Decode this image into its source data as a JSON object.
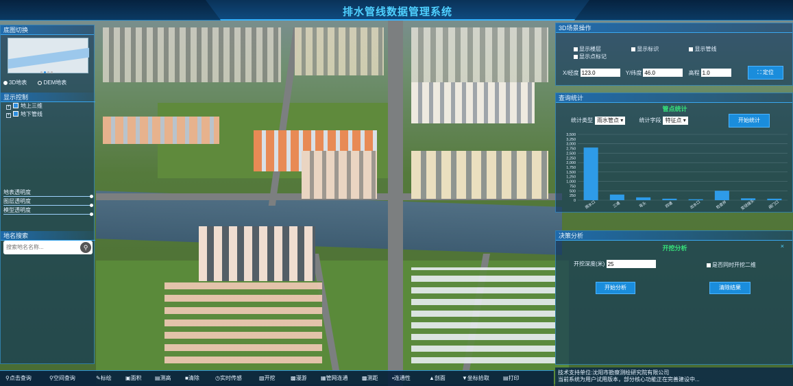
{
  "app": {
    "title": "排水管线数据管理系统"
  },
  "left_panel": {
    "basemap": {
      "header": "底图切换",
      "options": [
        {
          "label": "3D地表",
          "selected": true
        },
        {
          "label": "DEM地表",
          "selected": false
        }
      ]
    },
    "display_control": {
      "header": "显示控制",
      "layers": [
        {
          "label": "地上三维",
          "checked": true
        },
        {
          "label": "地下管线",
          "checked": true
        }
      ]
    },
    "sliders": [
      {
        "label": "地表透明度",
        "value_pct": 100
      },
      {
        "label": "图层透明度",
        "value_pct": 100
      },
      {
        "label": "模型透明度",
        "value_pct": 100
      }
    ],
    "place_search": {
      "header": "地名搜索",
      "placeholder": "搜索地名名称..."
    }
  },
  "right_panel": {
    "scene_ops": {
      "header": "3D场景操作",
      "checkboxes": [
        "显示楼层",
        "显示标识",
        "显示管线",
        "显示点标记"
      ],
      "x_label": "X/经度",
      "x_value": "123.0",
      "y_label": "Y/纬度",
      "y_value": "46.0",
      "z_label": "高程",
      "z_value": "1.0",
      "locate_button": "定位"
    },
    "query_stats": {
      "header": "查询统计",
      "subtitle": "管点统计",
      "type_label": "统计类型",
      "type_value": "雨水管点",
      "field_label": "统计字段",
      "field_value": "特征点",
      "button": "开始统计"
    },
    "decision": {
      "header": "决策分析",
      "subtitle": "开挖分析",
      "close": "×",
      "depth_label": "开挖深度(米)",
      "depth_value": "25",
      "checkbox_label": "是否同时开挖二维",
      "analyze_button": "开始分析",
      "clear_button": "清除结果"
    },
    "footer": {
      "line1": "技术支持单位:沈阳市勘察测绘研究院有限公司",
      "line2": "当前系统为用户试用版本，部分核心功能正在完善建设中..."
    }
  },
  "toolbar": {
    "items": [
      {
        "label": "点击查询",
        "icon": "search-icon"
      },
      {
        "label": "空间查询",
        "icon": "spatial-query-icon"
      },
      {
        "label": "标绘",
        "icon": "pen-icon"
      },
      {
        "label": "面积",
        "icon": "area-icon"
      },
      {
        "label": "测高",
        "icon": "height-icon"
      },
      {
        "label": "清除",
        "icon": "clear-icon"
      },
      {
        "label": "实时传感",
        "icon": "sensor-icon"
      },
      {
        "label": "开挖",
        "icon": "excavate-icon"
      },
      {
        "label": "漫游",
        "icon": "roam-icon"
      },
      {
        "label": "管网连通",
        "icon": "network-icon"
      },
      {
        "label": "测距",
        "icon": "measure-icon"
      },
      {
        "label": "连通性",
        "icon": "connectivity-icon"
      },
      {
        "label": "剖面",
        "icon": "profile-icon"
      },
      {
        "label": "坐标拾取",
        "icon": "pick-icon"
      },
      {
        "label": "打印",
        "icon": "print-icon"
      }
    ]
  },
  "colors": {
    "accent": "#1a8ddc",
    "title": "#4fd0ff",
    "subtitle": "#36e07a",
    "bar": "#2e9be8"
  },
  "chart_data": {
    "type": "bar",
    "categories": [
      "雨水口",
      "三通",
      "弯头",
      "四通",
      "出水口",
      "检查井",
      "变径接头",
      "阀门口"
    ],
    "values": [
      2800,
      300,
      150,
      80,
      50,
      500,
      100,
      80
    ],
    "ylim": [
      0,
      3500
    ],
    "yticks": [
      "0",
      "250",
      "500",
      "750",
      "1,000",
      "1,250",
      "1,500",
      "1,750",
      "2,000",
      "2,250",
      "2,500",
      "2,750",
      "3,000",
      "3,250",
      "3,500"
    ],
    "grid": true
  }
}
